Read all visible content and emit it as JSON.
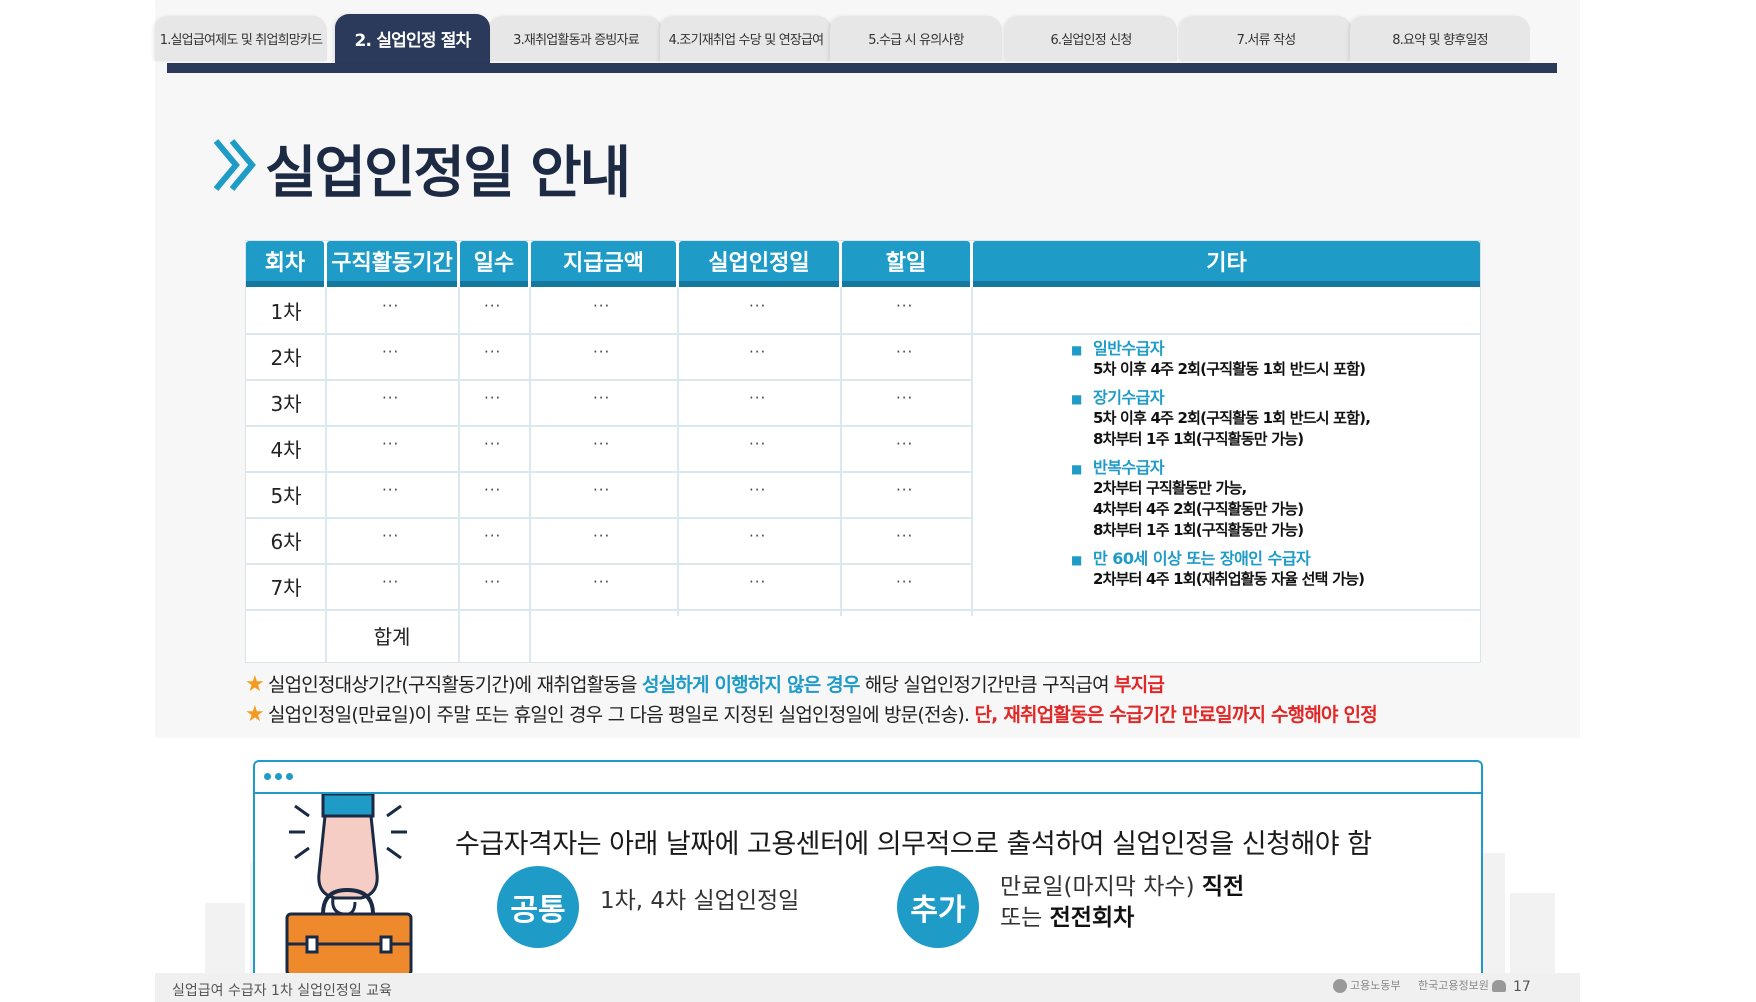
{
  "tabs": [
    {
      "label": "1.실업급여제도 및 취업희망카드",
      "active": false
    },
    {
      "label": "2. 실업인정 절차",
      "active": true
    },
    {
      "label": "3.재취업활동과 증빙자료",
      "active": false
    },
    {
      "label": "4.조기재취업 수당 및 연장급여",
      "active": false
    },
    {
      "label": "5.수급 시 유의사항",
      "active": false
    },
    {
      "label": "6.실업인정 신청",
      "active": false
    },
    {
      "label": "7.서류 작성",
      "active": false
    },
    {
      "label": "8.요약 및 향후일정",
      "active": false
    }
  ],
  "title": "실업인정일 안내",
  "table": {
    "headers": [
      "회차",
      "구직활동기간",
      "일수",
      "지급금액",
      "실업인정일",
      "할일",
      "기타"
    ],
    "rows": [
      "1차",
      "2차",
      "3차",
      "4차",
      "5차",
      "6차",
      "7차"
    ],
    "cell_placeholder": "···",
    "total_label": "합계",
    "notes": [
      {
        "head": "일반수급자",
        "lines": [
          "5차  이후 4주 2회(구직활동 1회 반드시 포함)"
        ]
      },
      {
        "head": "장기수급자",
        "lines": [
          "5차  이후 4주 2회(구직활동 1회 반드시 포함),",
          "8차부터 1주 1회(구직활동만 가능)"
        ]
      },
      {
        "head": "반복수급자",
        "lines": [
          "2차부터 구직활동만 가능,",
          "4차부터 4주 2회(구직활동만 가능)",
          "8차부터 1주 1회(구직활동만 가능)"
        ]
      },
      {
        "head": "만 60세 이상 또는 장애인 수급자",
        "lines": [
          "2차부터 4주 1회(재취업활동 자율 선택 가능)"
        ]
      }
    ]
  },
  "footnotes": {
    "line1": {
      "a": "실업인정대상기간(구직활동기간)에 재취업활동을 ",
      "b": "성실하게 이행하지 않은 경우",
      "c": " 해당 실업인정기간만큼 구직급여 ",
      "d": "부지급"
    },
    "line2": {
      "a": "실업인정일(만료일)이 주말 또는 휴일인 경우 그 다음 평일로 지정된 실업인정일에 방문(전송). ",
      "b": "단, 재취업활동은 수급기간 만료일까지 수행해야 인정"
    }
  },
  "panel": {
    "main_text": "수급자격자는 아래 날짜에 고용센터에 의무적으로 출석하여 실업인정을 신청해야 함",
    "common_label": "공통",
    "common_text": "1차, 4차 실업인정일",
    "extra_label": "추가",
    "extra_line1_pre": "만료일(마지막 차수) ",
    "extra_line1_bold": "직전",
    "extra_line2_pre": "또는 ",
    "extra_line2_bold": "전전회차"
  },
  "footer": {
    "caption": "실업급여 수급자 1차 실업인정일 교육",
    "logo_ministry": "고용노동부",
    "logo_agency": "한국고용정보원",
    "page": "17"
  },
  "colors": {
    "accent": "#1f9bc7",
    "navy": "#2b3a5a",
    "red": "#e02828",
    "star": "#f39a1f"
  }
}
